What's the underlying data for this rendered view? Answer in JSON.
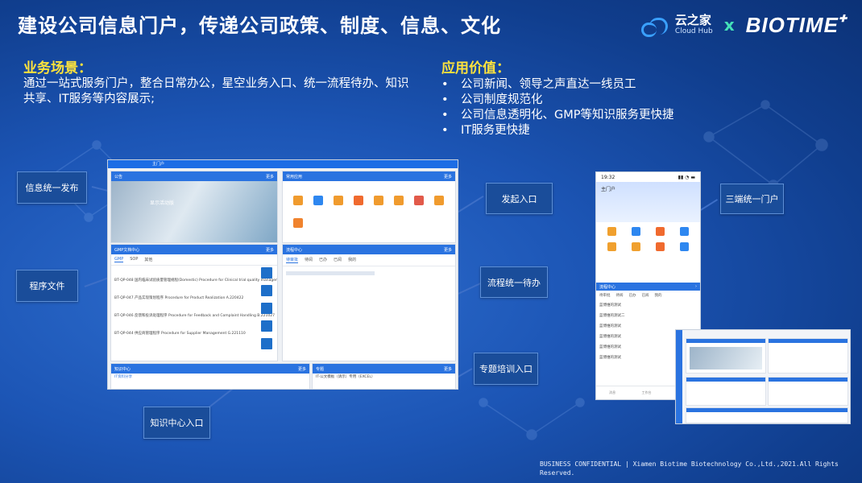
{
  "title": "建设公司信息门户，传递公司政策、制度、信息、文化",
  "logo": {
    "yzj_zh": "云之家",
    "yzj_en": "Cloud Hub",
    "x": "x",
    "brand": "BIOTIME"
  },
  "left_section": {
    "heading": "业务场景：",
    "body": "通过一站式服务门户，整合日常办公，星空业务入口、统一流程待办、知识共享、IT服务等内容展示;"
  },
  "right_section": {
    "heading": "应用价值：",
    "items": [
      "公司新闻、领导之声直达一线员工",
      "公司制度规范化",
      "公司信息透明化、GMP等知识服务更快捷",
      "IT服务更快捷"
    ]
  },
  "labels": {
    "publish": "信息统一发布",
    "procedure": "程序文件",
    "knowledge": "知识中心入口",
    "launch": "发起入口",
    "workflow": "流程统一待办",
    "training": "专题培训入口",
    "portal": "三端统一门户"
  },
  "screenshot": {
    "tab_title": "主门户",
    "announce": "公告",
    "common": "常用应用",
    "more": "更多",
    "banner_title": "显示活动版",
    "gmp_panel": "GMP文档中心",
    "gmp_tabs": [
      "GMP",
      "SOP",
      "其他"
    ],
    "gmp_rows": [
      "BT-QP-048 国内临床试验质量管理规程(Domestic) Procedure for Clinical trial quality manageme",
      "BT-QP-047 产品实现策划程序 Procedure for Product Realization A.220422",
      "BT-QP-046 反馈和投诉处理程序 Procedure for Feedback and Complaint Handling B.221027",
      "BT-QP-044 供应商管理程序 Procedure for Supplier Management G.221110"
    ],
    "flow_panel": "流程中心",
    "flow_tabs": [
      "待审批",
      "待阅",
      "已办",
      "已阅",
      "我的"
    ],
    "knowledge_panel": "知识中心",
    "knowledge_item": "IT资料分享",
    "training_panel": "专题",
    "training_item": "IT-公文模板（请示）专用（EXCEL）"
  },
  "phone": {
    "time": "19:32",
    "portal": "主门户",
    "flow": "流程中心",
    "tabs": [
      "待审批",
      "待阅",
      "已办",
      "已阅",
      "我的"
    ],
    "items": [
      "蓝博维的测试",
      "蓝博维的测试二",
      "蓝博维的测试",
      "蓝博维的测试",
      "蓝博维的测试",
      "蓝博维的测试"
    ],
    "nav": [
      "消息",
      "工作台",
      "通讯录"
    ]
  },
  "footer": "BUSINESS CONFIDENTIAL | Xiamen Biotime Biotechnology Co.,Ltd.,2021.All Rights Reserved.",
  "colors": {
    "accent": "#ffe33c",
    "bg": "#1c55b5",
    "brand_blue": "#2a73e0"
  }
}
